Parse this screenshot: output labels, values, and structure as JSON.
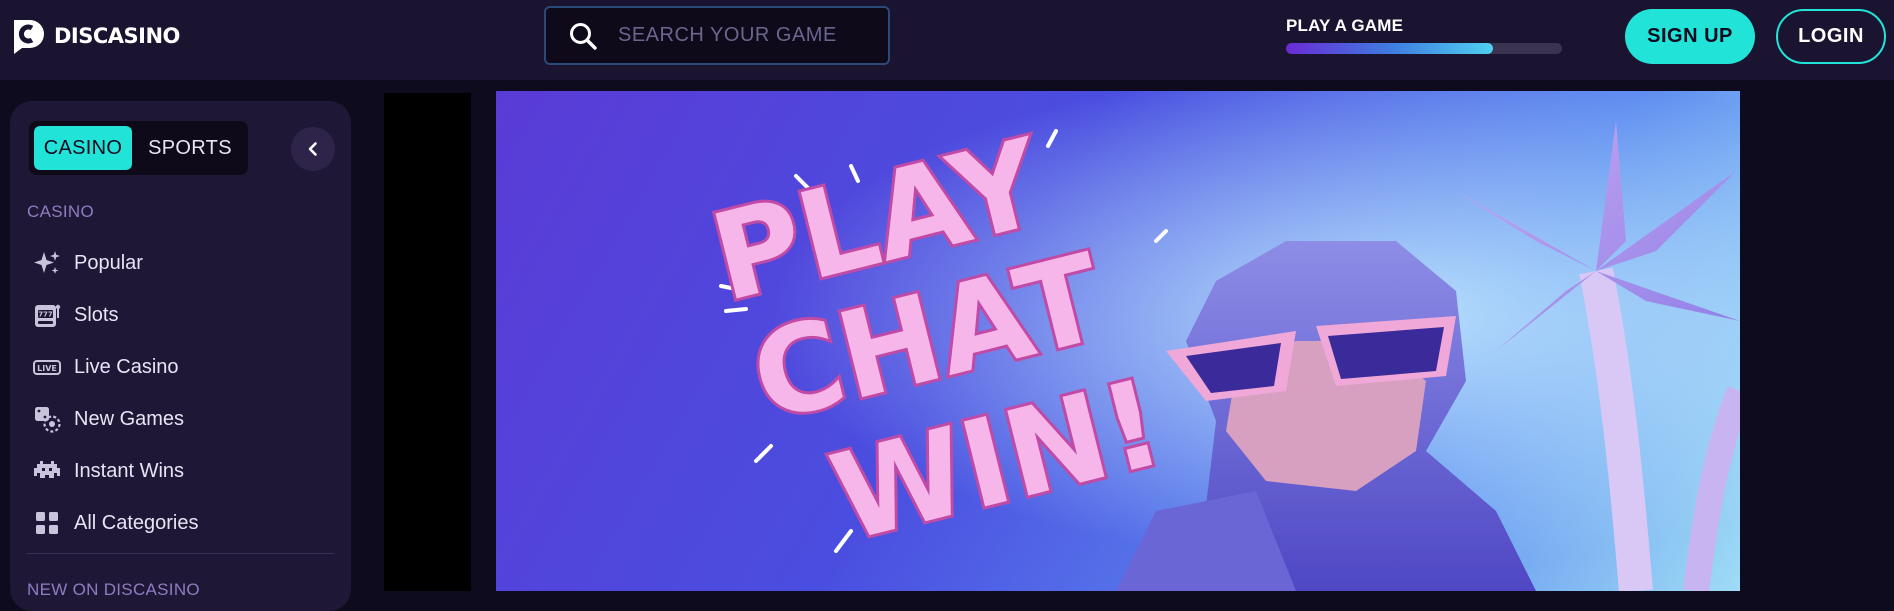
{
  "header": {
    "logo_text": "DISCASINO",
    "search_placeholder": "SEARCH YOUR GAME",
    "progress": {
      "label": "PLAY A GAME",
      "value_percent": 75
    },
    "signup_label": "SIGN UP",
    "login_label": "LOGIN"
  },
  "sidebar": {
    "tabs": [
      {
        "label": "CASINO",
        "active": true
      },
      {
        "label": "SPORTS",
        "active": false
      }
    ],
    "section_casino": "CASINO",
    "items": [
      {
        "label": "Popular",
        "icon": "sparkles-icon"
      },
      {
        "label": "Slots",
        "icon": "slot-machine-icon"
      },
      {
        "label": "Live Casino",
        "icon": "live-badge-icon"
      },
      {
        "label": "New Games",
        "icon": "dice-icon"
      },
      {
        "label": "Instant Wins",
        "icon": "space-invader-icon"
      },
      {
        "label": "All Categories",
        "icon": "grid-icon"
      }
    ],
    "section_new": "NEW ON DISCASINO"
  },
  "banner": {
    "headline": [
      "PLAY",
      "CHAT",
      "WIN!"
    ]
  },
  "colors": {
    "accent": "#22e3d8",
    "header_bg": "#1b1430",
    "sidebar_bg": "#1e1735",
    "page_bg": "#0f0b1f"
  }
}
